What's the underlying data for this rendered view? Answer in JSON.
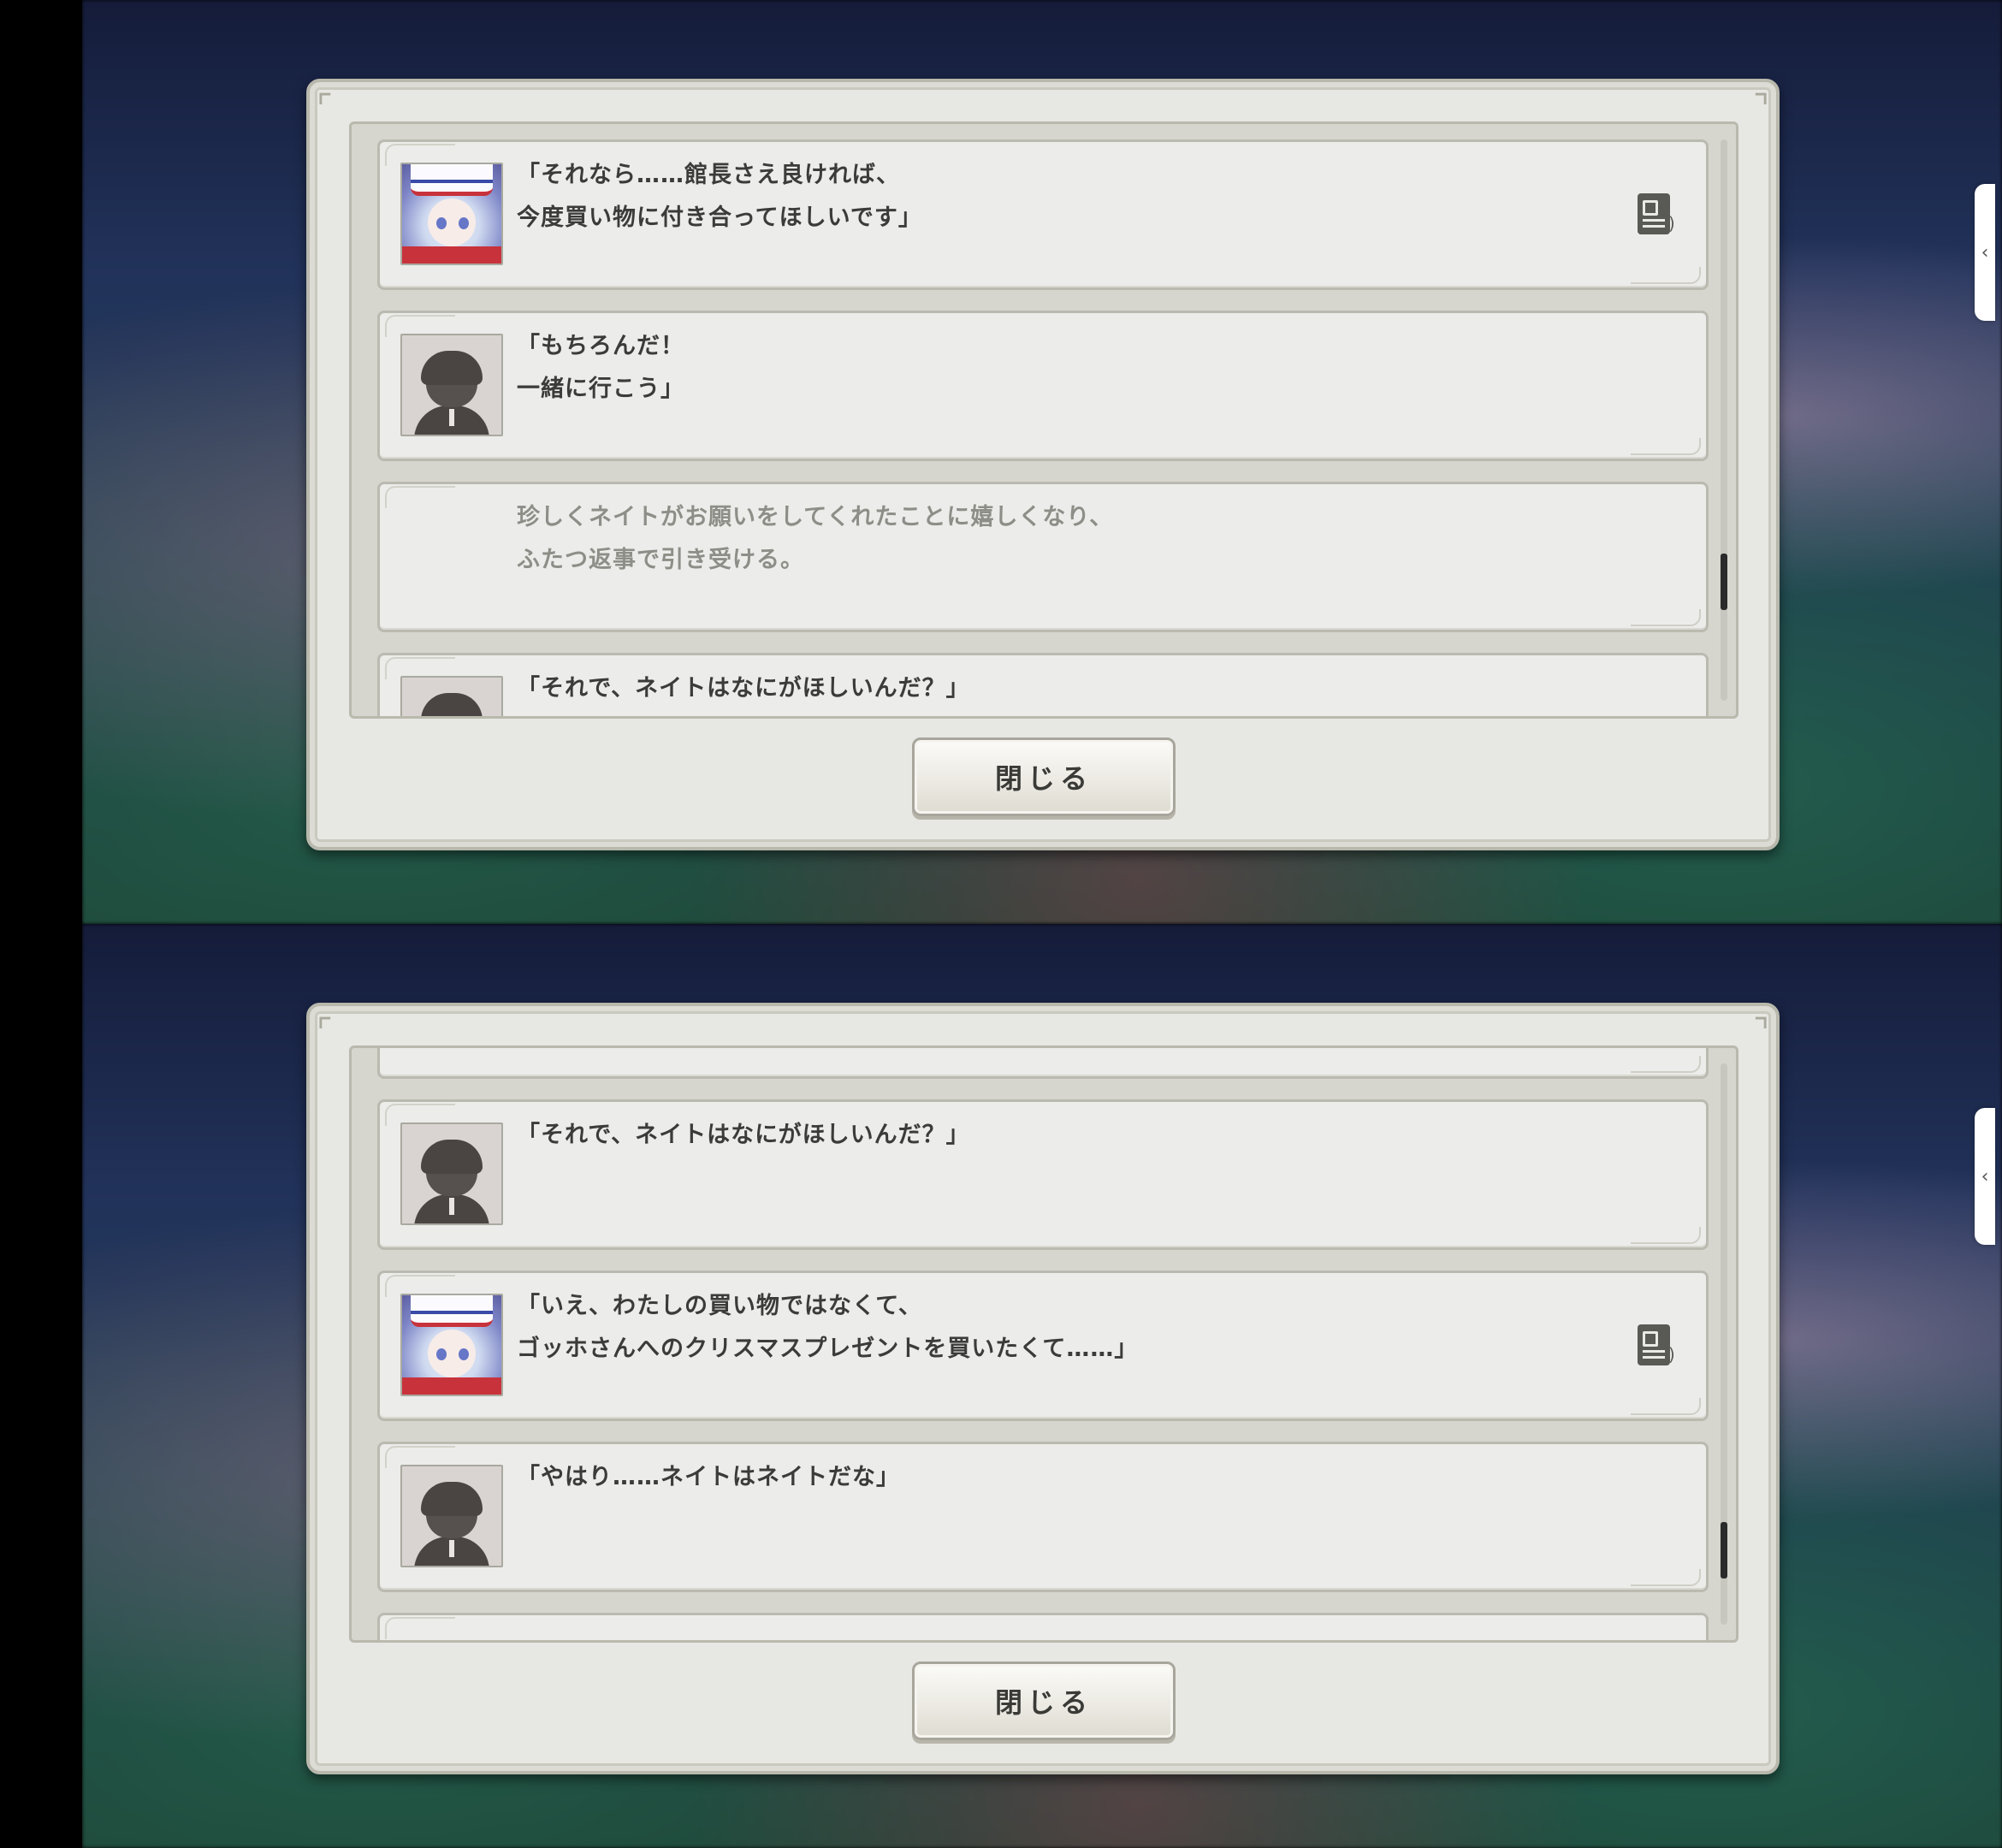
{
  "screens": [
    {
      "entries": [
        {
          "speaker": "girl",
          "text": "「それなら……館長さえ良ければ、\n 今度買い物に付き合ってほしいです」",
          "voice": true
        },
        {
          "speaker": "boy",
          "text": "「もちろんだ！\n 一緒に行こう」",
          "voice": false
        },
        {
          "speaker": "narration",
          "text": "珍しくネイトがお願いをしてくれたことに嬉しくなり、\nふたつ返事で引き受ける。",
          "voice": false
        },
        {
          "speaker": "boy",
          "text": "「それで、ネイトはなにがほしいんだ？」",
          "voice": false
        }
      ],
      "close_label": "閉じる",
      "scroll_position": 0.5
    },
    {
      "entries": [
        {
          "speaker": "blank",
          "text": "",
          "voice": false
        },
        {
          "speaker": "boy",
          "text": "「それで、ネイトはなにがほしいんだ？」",
          "voice": false
        },
        {
          "speaker": "girl",
          "text": "「いえ、わたしの買い物ではなくて、\n ゴッホさんへのクリスマスプレゼントを買いたくて……」",
          "voice": true
        },
        {
          "speaker": "boy",
          "text": "「やはり……ネイトはネイトだな」",
          "voice": false
        }
      ],
      "close_label": "閉じる",
      "scroll_position": 0.65
    }
  ],
  "side_tab_glyph": "‹",
  "icons": {
    "voice": "voice-replay-icon",
    "close": "close-button"
  }
}
